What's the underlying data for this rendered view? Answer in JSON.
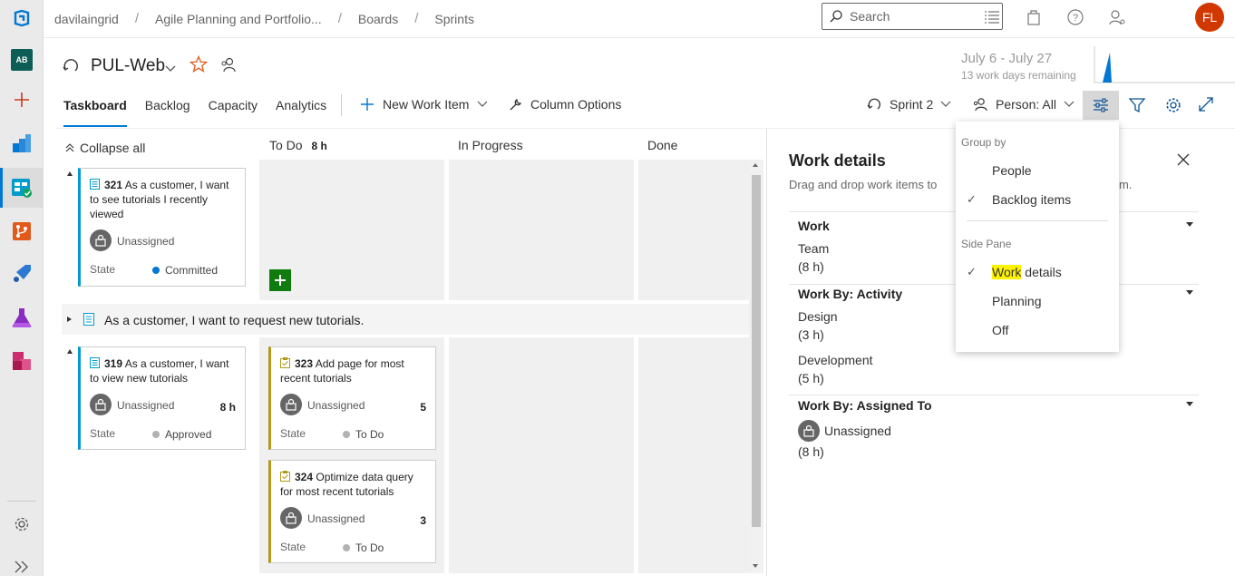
{
  "breadcrumb": {
    "org": "davilaingrid",
    "project": "Agile Planning and Portfolio...",
    "hub": "Boards",
    "page": "Sprints"
  },
  "search": {
    "placeholder": "Search"
  },
  "user": {
    "initials": "FL"
  },
  "rail": {
    "org_badge": "AB"
  },
  "header": {
    "team": "PUL-Web",
    "sprint_dates": "July 6 - July 27",
    "sprint_remaining": "13 work days remaining"
  },
  "tabs": [
    {
      "label": "Taskboard"
    },
    {
      "label": "Backlog"
    },
    {
      "label": "Capacity"
    },
    {
      "label": "Analytics"
    }
  ],
  "commands": {
    "new_work_item": "New Work Item",
    "column_options": "Column Options",
    "sprint": "Sprint 2",
    "person": "Person: All"
  },
  "board": {
    "collapse_all": "Collapse all",
    "columns": {
      "todo": "To Do",
      "todo_hours": "8 h",
      "in_progress": "In Progress",
      "done": "Done"
    },
    "collapsed_row": "As a customer, I want to request new tutorials.",
    "state_label": "State",
    "cards": {
      "c321": {
        "id": "321",
        "title": "As a customer, I want to see tutorials I recently viewed",
        "assignee": "Unassigned",
        "state": "Committed",
        "state_color": "#0078d4"
      },
      "c319": {
        "id": "319",
        "title": "As a customer, I want to view new tutorials",
        "assignee": "Unassigned",
        "remaining": "8 h",
        "state": "Approved",
        "state_color": "#b2b2b2"
      },
      "c323": {
        "id": "323",
        "title": "Add page for most recent tutorials",
        "assignee": "Unassigned",
        "remaining": "5",
        "state": "To Do",
        "state_color": "#b2b2b2"
      },
      "c324": {
        "id": "324",
        "title": "Optimize data query for most recent tutorials",
        "assignee": "Unassigned",
        "remaining": "3",
        "state": "To Do",
        "state_color": "#b2b2b2"
      }
    }
  },
  "pane": {
    "title": "Work details",
    "description_start": "Drag and drop work items to",
    "description_end": "m.",
    "sections": {
      "work": {
        "heading": "Work",
        "name": "Team",
        "value": "(8 h)"
      },
      "activity": {
        "heading": "Work By: Activity",
        "a1": "Design",
        "v1": "(3 h)",
        "a2": "Development",
        "v2": "(5 h)"
      },
      "assigned": {
        "heading": "Work By: Assigned To",
        "name": "Unassigned",
        "value": "(8 h)"
      }
    }
  },
  "menu": {
    "group_by": "Group by",
    "people": "People",
    "backlog_items": "Backlog items",
    "side_pane": "Side Pane",
    "work_details_hl": "Work",
    "work_details_rest": " details",
    "planning": "Planning",
    "off": "Off"
  }
}
